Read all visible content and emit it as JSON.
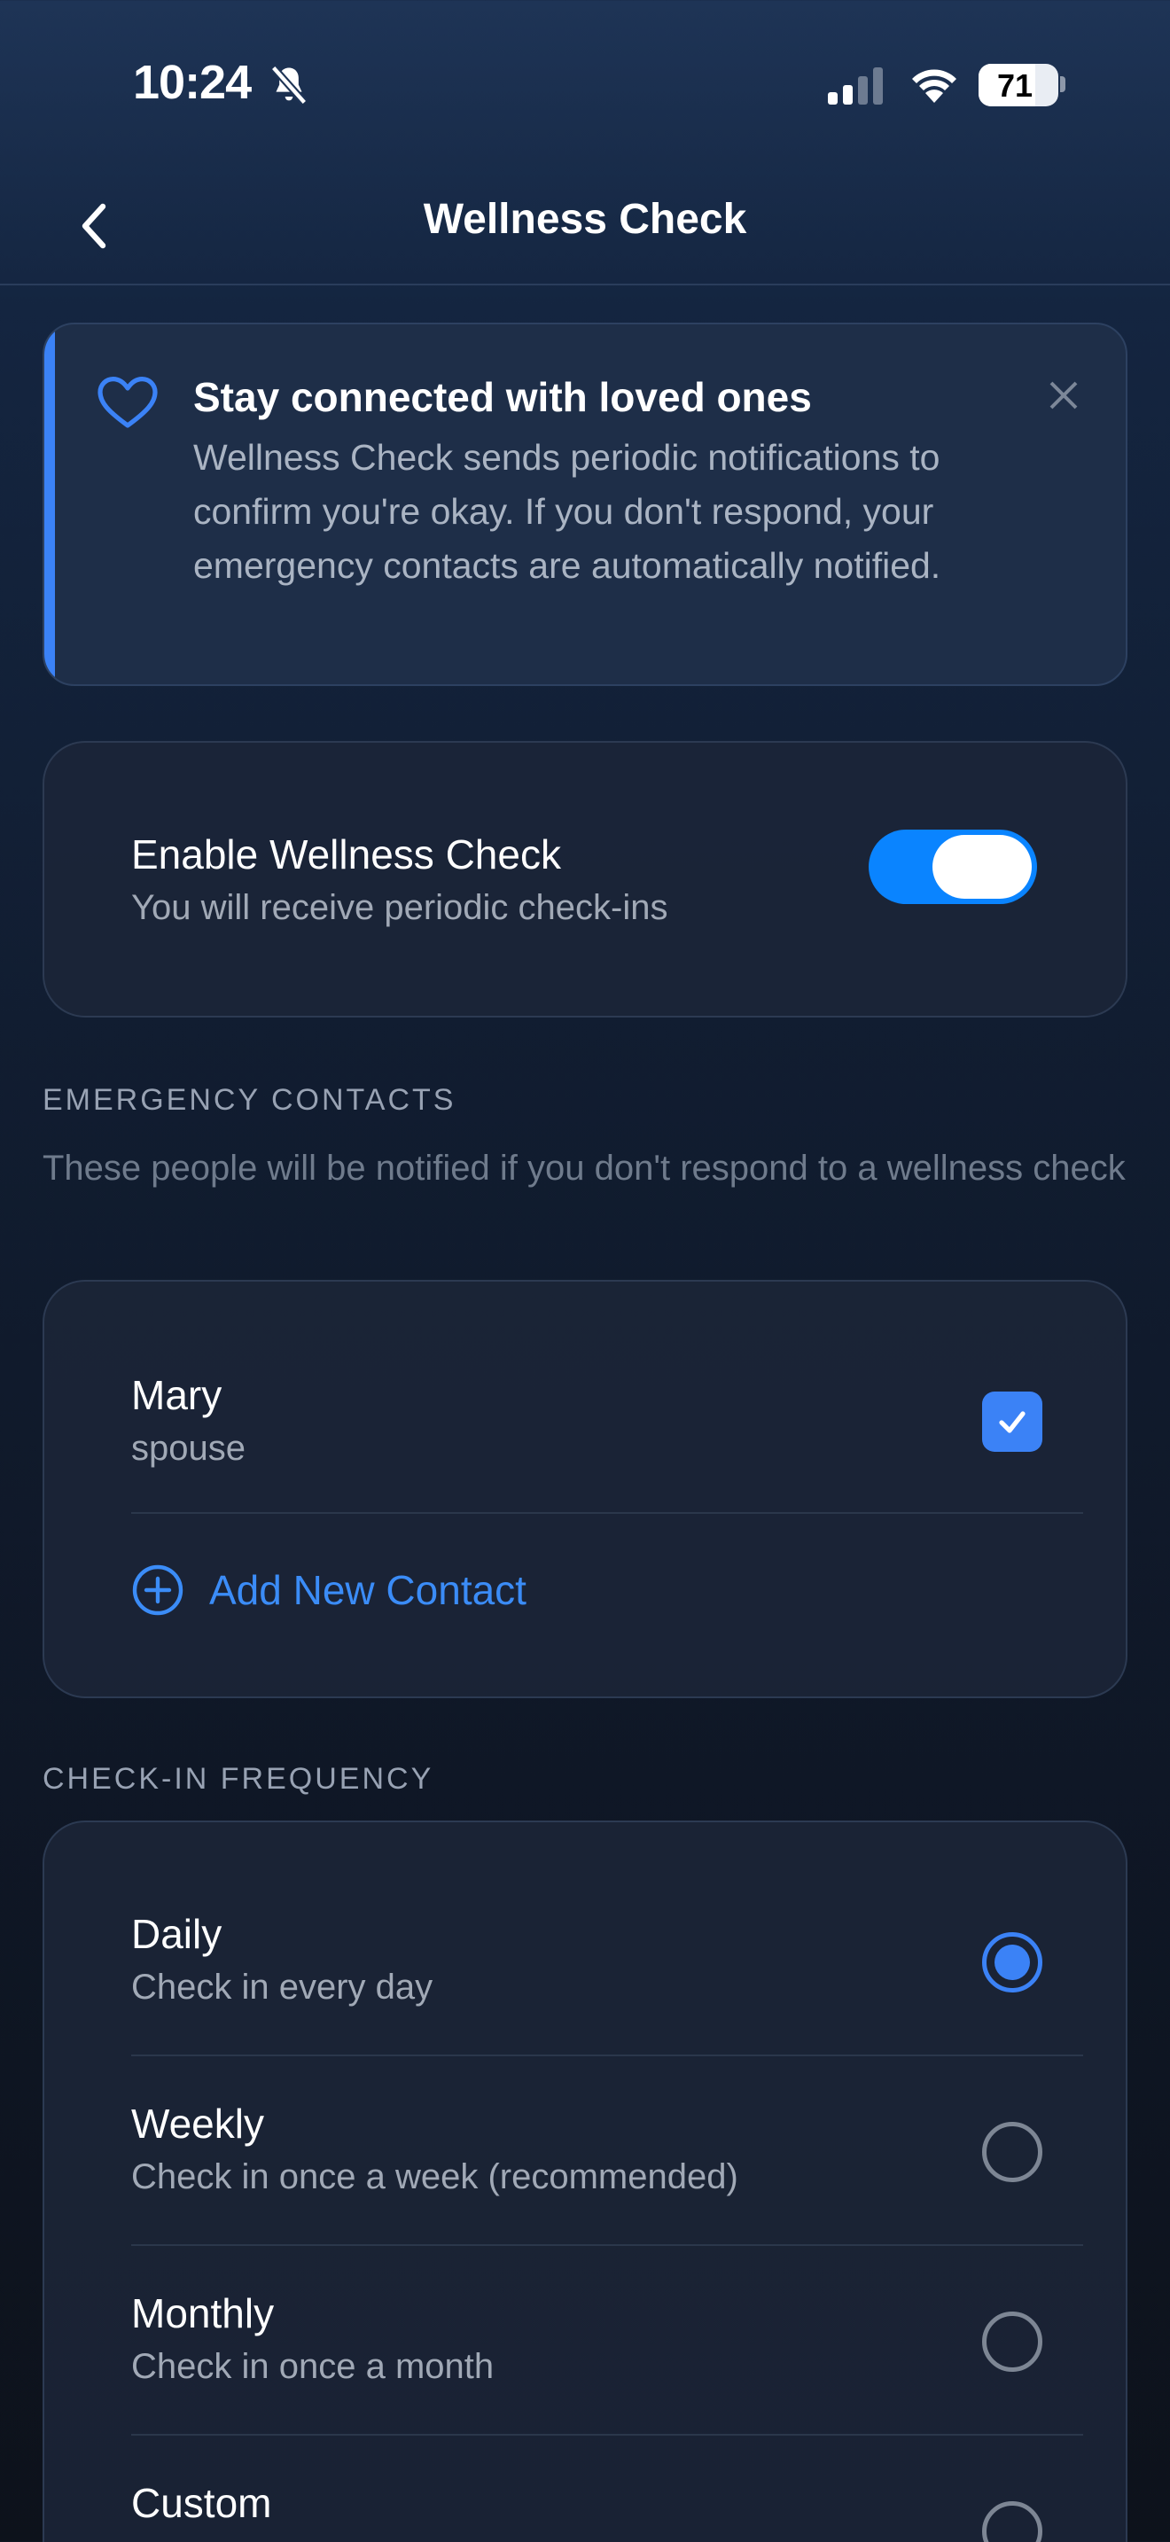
{
  "status_bar": {
    "time": "10:24",
    "battery": "71"
  },
  "nav": {
    "title": "Wellness Check"
  },
  "banner": {
    "title": "Stay connected with loved ones",
    "text": "Wellness Check sends periodic notifications to confirm you're okay. If you don't respond, your emergency contacts are automatically notified."
  },
  "enable": {
    "title": "Enable Wellness Check",
    "subtitle": "You will receive periodic check-ins",
    "enabled": true
  },
  "contacts": {
    "section_label": "EMERGENCY CONTACTS",
    "description": "These people will be notified if you don't respond to a wellness check",
    "items": [
      {
        "name": "Mary",
        "relation": "spouse",
        "checked": true
      }
    ],
    "add_label": "Add New Contact"
  },
  "frequency": {
    "section_label": "CHECK-IN FREQUENCY",
    "options": [
      {
        "label": "Daily",
        "description": "Check in every day",
        "selected": true
      },
      {
        "label": "Weekly",
        "description": "Check in once a week (recommended)",
        "selected": false
      },
      {
        "label": "Monthly",
        "description": "Check in once a month",
        "selected": false
      },
      {
        "label": "Custom",
        "description": "",
        "selected": false
      }
    ]
  },
  "colors": {
    "accent": "#3b82f6",
    "toggle_on": "#0a84ff",
    "background_top": "#1e3456",
    "background_bottom": "#0d121b"
  },
  "icons": {
    "status": [
      "bell-off-icon",
      "cellular-signal-icon",
      "wifi-icon",
      "battery-icon"
    ],
    "nav": "chevron-left-icon",
    "banner": [
      "heart-icon",
      "close-icon"
    ],
    "contacts": [
      "checkmark-icon",
      "plus-circle-icon"
    ]
  }
}
